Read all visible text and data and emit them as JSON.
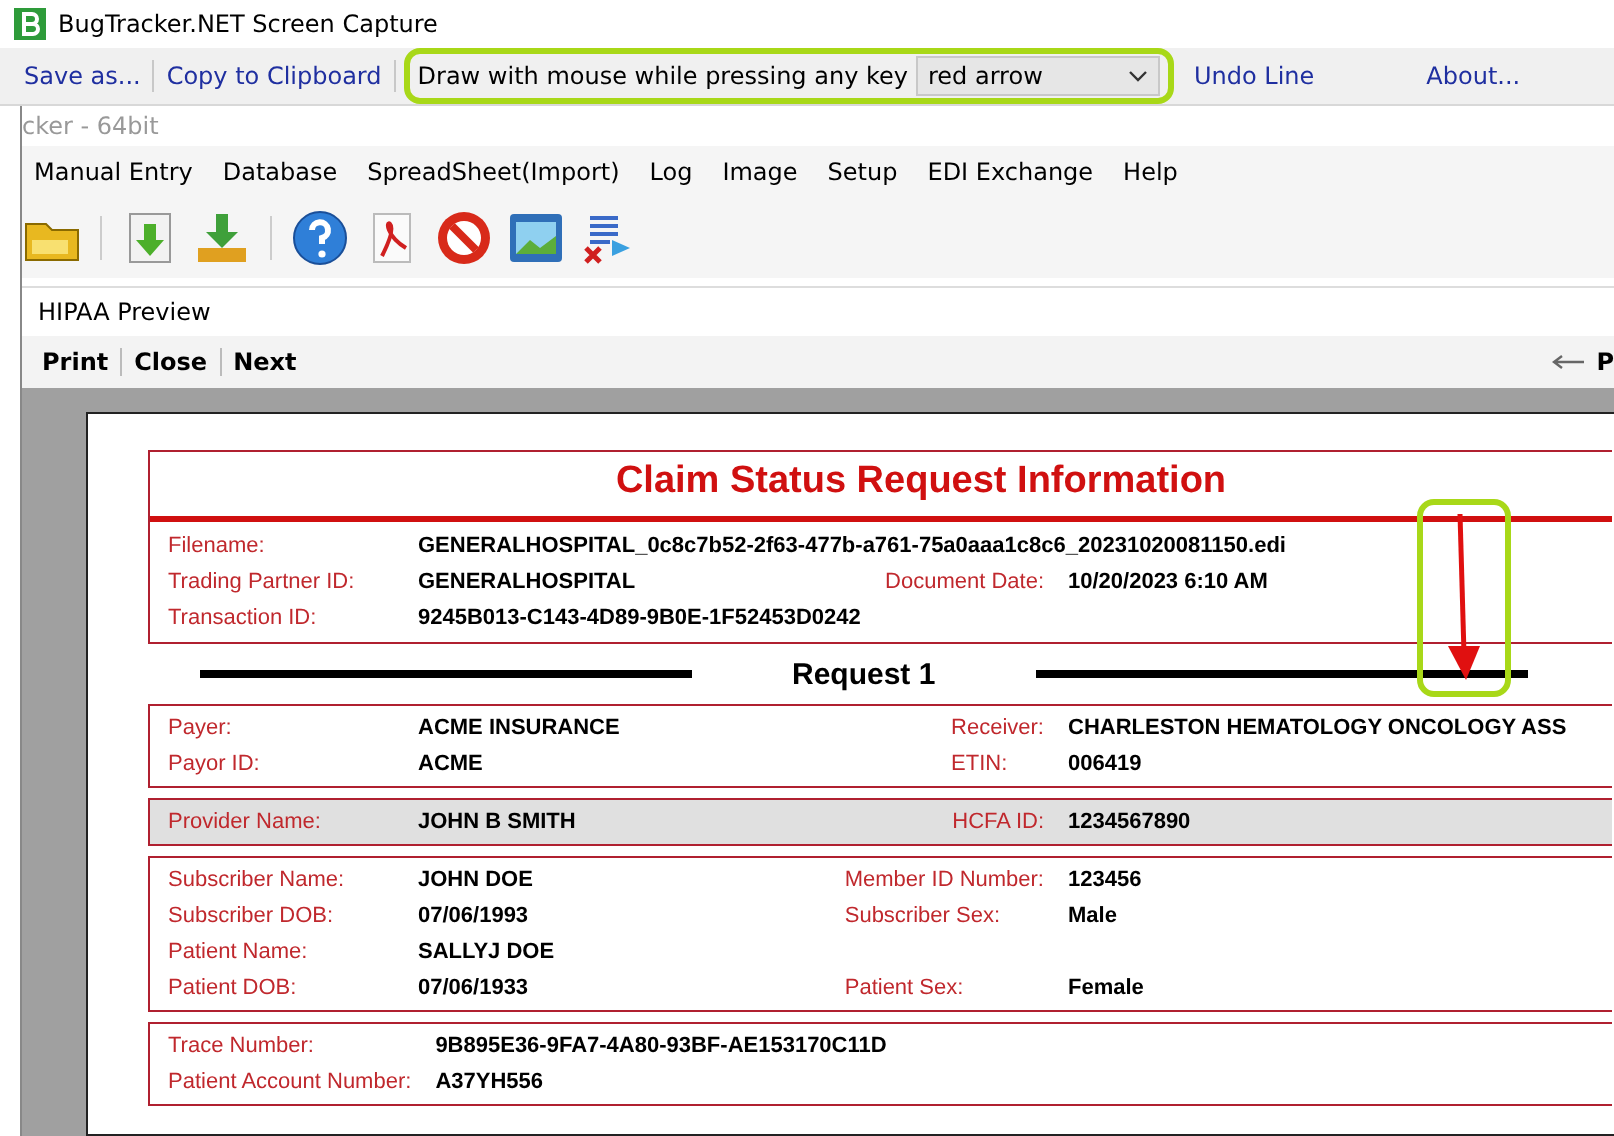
{
  "window": {
    "title": "BugTracker.NET Screen Capture"
  },
  "capture_toolbar": {
    "buttons": [
      "Save as...",
      "Copy to Clipboard"
    ],
    "draw_label": "Draw with mouse while pressing any key",
    "draw_mode": "red arrow",
    "links": [
      "Undo Line",
      "About..."
    ]
  },
  "app": {
    "title": "cker - 64bit",
    "menu": [
      "Manual Entry",
      "Database",
      "SpreadSheet(Import)",
      "Log",
      "Image",
      "Setup",
      "EDI Exchange",
      "Help"
    ]
  },
  "preview": {
    "title": "HIPAA Preview",
    "buttons": [
      "Print",
      "Close",
      "Next"
    ],
    "page_label": "P"
  },
  "document": {
    "title": "Claim Status Request Information",
    "header_rows": [
      [
        {
          "label": "Filename:",
          "value": "GENERALHOSPITAL_0c8c7b52-2f63-477b-a761-75a0aaa1c8c6_20231020081150.edi"
        }
      ],
      [
        {
          "label": "Trading Partner ID:",
          "value": "GENERALHOSPITAL"
        },
        {
          "label": "Document Date:",
          "value": "10/20/2023 6:10 AM"
        }
      ],
      [
        {
          "label": "Transaction ID:",
          "value": "9245B013-C143-4D89-9B0E-1F52453D0242"
        }
      ]
    ],
    "request_title": "Request 1",
    "sections": [
      {
        "kind": "plain",
        "rows": [
          [
            {
              "label": "Payer:",
              "value": "ACME INSURANCE"
            },
            {
              "label": "Receiver:",
              "value": "CHARLESTON HEMATOLOGY ONCOLOGY ASS"
            }
          ],
          [
            {
              "label": "Payor ID:",
              "value": "ACME"
            },
            {
              "label": "ETIN:",
              "value": "006419"
            }
          ]
        ]
      },
      {
        "kind": "shaded",
        "rows": [
          [
            {
              "label": "Provider Name:",
              "value": "JOHN B  SMITH"
            },
            {
              "label": "HCFA ID:",
              "value": "1234567890"
            }
          ]
        ]
      },
      {
        "kind": "plain",
        "rows": [
          [
            {
              "label": "Subscriber Name:",
              "value": "JOHN   DOE"
            },
            {
              "label": "Member ID Number:",
              "value": "123456"
            }
          ],
          [
            {
              "label": "Subscriber DOB:",
              "value": "07/06/1993"
            },
            {
              "label": "Subscriber Sex:",
              "value": "Male"
            }
          ],
          [
            {
              "label": "Patient Name:",
              "value": "SALLYJ  DOE"
            }
          ],
          [
            {
              "label": "Patient DOB:",
              "value": "07/06/1933"
            },
            {
              "label": "Patient Sex:",
              "value": "Female"
            }
          ]
        ]
      },
      {
        "kind": "plain",
        "rows": [
          [
            {
              "label": "Trace Number:",
              "value": "9B895E36-9FA7-4A80-93BF-AE153170C11D"
            }
          ],
          [
            {
              "label": "Patient Account Number:",
              "value": "A37YH556"
            }
          ]
        ]
      }
    ]
  }
}
